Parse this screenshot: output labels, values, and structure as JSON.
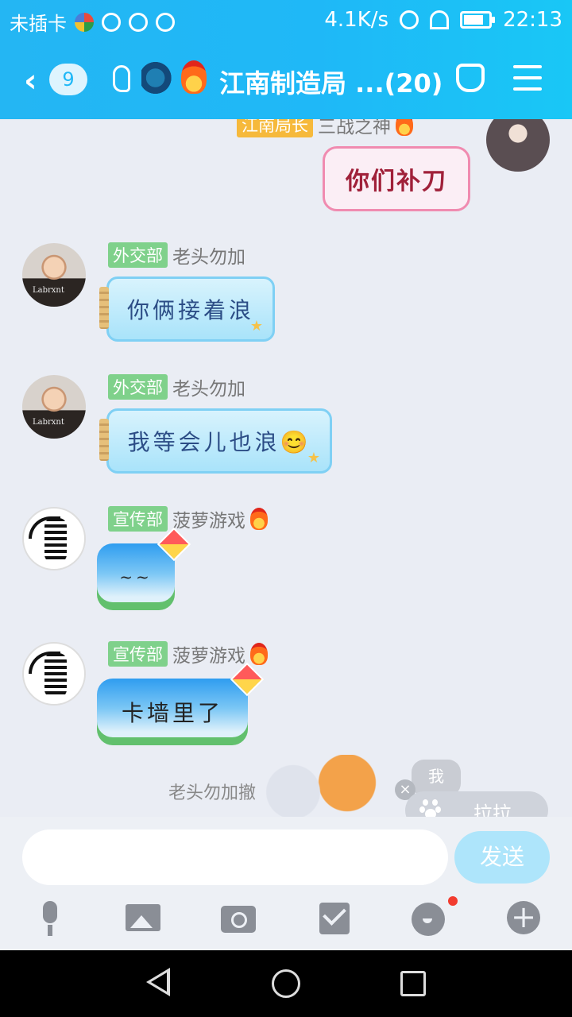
{
  "status_bar": {
    "carrier": "未插卡",
    "net_speed": "4.1K/s",
    "time": "22:13"
  },
  "header": {
    "back_count": "9",
    "group_title": "江南制造局 ...(20)"
  },
  "messages": [
    {
      "sender_role": "江南局长",
      "sender_name": "三战之神",
      "text": "你们补刀",
      "side": "right"
    },
    {
      "sender_role": "外交部",
      "sender_name": "老头勿加",
      "text": "你俩接着浪",
      "side": "left"
    },
    {
      "sender_role": "外交部",
      "sender_name": "老头勿加",
      "text": "我等会儿也浪😊",
      "side": "left"
    },
    {
      "sender_role": "宣传部",
      "sender_name": "菠萝游戏",
      "text": "~~",
      "side": "left"
    },
    {
      "sender_role": "宣传部",
      "sender_name": "菠萝游戏",
      "text": "卡墙里了",
      "side": "left"
    }
  ],
  "recall_notice": "老头勿加撤",
  "pet": {
    "bubble_text": "我",
    "close_symbol": "×",
    "button_label": "拉拉"
  },
  "input": {
    "placeholder": "",
    "send_label": "发送"
  },
  "toolbar_icons": [
    "microphone-icon",
    "image-icon",
    "camera-icon",
    "red-packet-icon",
    "emoji-icon",
    "plus-icon"
  ],
  "colors": {
    "header": "#1fb8f7",
    "role_green": "#7fd18b",
    "role_gold": "#f6b93b",
    "send_button": "#aee5fb",
    "chat_bg": "#eaedf4"
  }
}
